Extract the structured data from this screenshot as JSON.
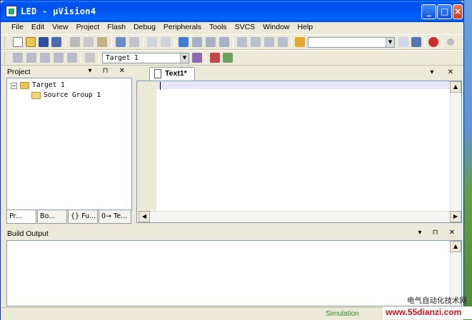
{
  "window": {
    "title": "LED  - µVision4"
  },
  "titlebar_buttons": {
    "minimize": "_",
    "maximize": "□",
    "close": "×"
  },
  "menu": [
    "File",
    "Edit",
    "View",
    "Project",
    "Flash",
    "Debug",
    "Peripherals",
    "Tools",
    "SVCS",
    "Window",
    "Help"
  ],
  "toolbar2": {
    "target_value": "Target 1"
  },
  "project_panel": {
    "title": "Project",
    "tree": {
      "root_label": "Target 1",
      "root_expander": "−",
      "child_label": "Source Group 1"
    },
    "tabs": [
      "Pr...",
      "Bo...",
      "{} Fu...",
      "0→ Te..."
    ]
  },
  "editor": {
    "tab_label": "Text1*"
  },
  "build_output": {
    "title": "Build Output"
  },
  "status": {
    "mode": "Simulation"
  },
  "watermark": {
    "cn_text": "电气自动化技术网",
    "url": "www.55dianzi.com"
  },
  "panel_controls": "▾ ⊓ ✕"
}
